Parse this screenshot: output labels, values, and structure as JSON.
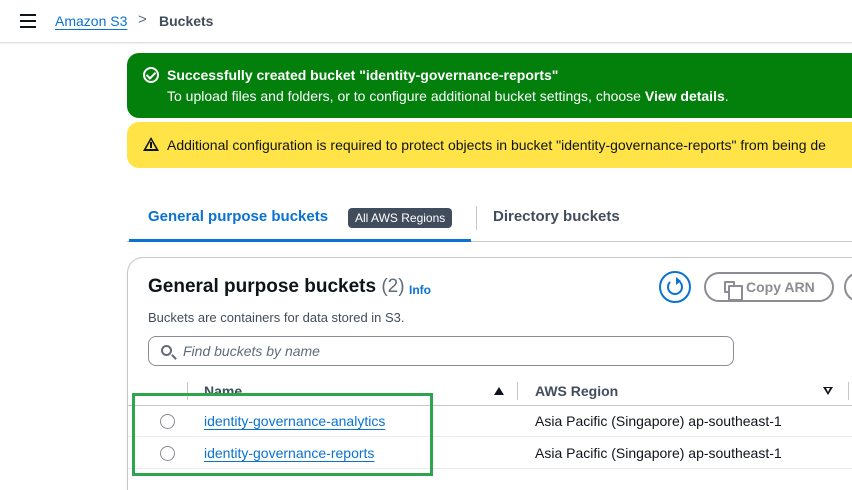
{
  "breadcrumb": {
    "root": "Amazon S3",
    "separator": ">",
    "current": "Buckets"
  },
  "flash_success": {
    "title": "Successfully created bucket \"identity-governance-reports\"",
    "desc_prefix": "To upload files and folders, or to configure additional bucket settings, choose ",
    "desc_action": "View details",
    "desc_suffix": "."
  },
  "flash_warning": {
    "text": "Additional configuration is required to protect objects in bucket \"identity-governance-reports\" from being de"
  },
  "tabs": {
    "general": "General purpose buckets",
    "general_badge": "All AWS Regions",
    "directory": "Directory buckets"
  },
  "panel": {
    "title": "General purpose buckets",
    "count": "(2)",
    "info": "Info",
    "description": "Buckets are containers for data stored in S3.",
    "copy_arn": "Copy ARN",
    "search_placeholder": "Find buckets by name"
  },
  "table": {
    "columns": [
      "Name",
      "AWS Region"
    ],
    "rows": [
      {
        "name": "identity-governance-analytics",
        "region": "Asia Pacific (Singapore) ap-southeast-1"
      },
      {
        "name": "identity-governance-reports",
        "region": "Asia Pacific (Singapore) ap-southeast-1"
      }
    ]
  },
  "icons": {
    "menu": "menu-icon",
    "success": "check-circle-icon",
    "warning": "warning-icon",
    "refresh": "refresh-icon",
    "copy": "copy-icon",
    "search": "search-icon"
  },
  "colors": {
    "success": "#037f0c",
    "warning": "#ffe347",
    "link": "#0972d3",
    "highlight": "#2ea44f"
  }
}
